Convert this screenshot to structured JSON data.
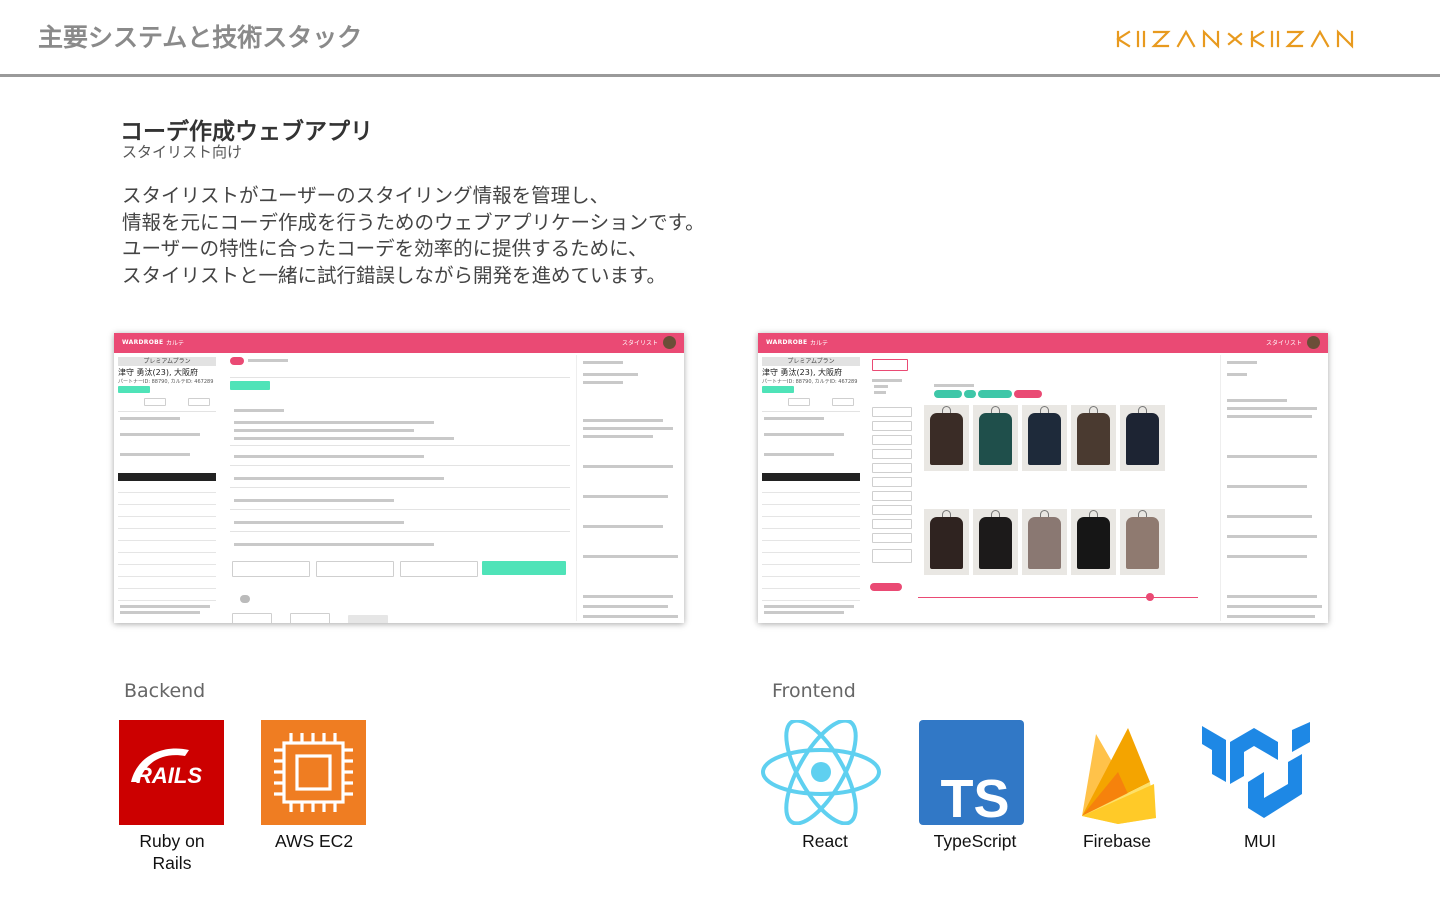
{
  "header": {
    "title": "主要システムと技術スタック",
    "brand_logo_text": "KIIZAN × KIIZAN"
  },
  "section": {
    "title": "コーデ作成ウェブアプリ",
    "subtitle": "スタイリスト向け",
    "description_lines": [
      "スタイリストがユーザーのスタイリング情報を管理し、",
      "情報を元にコーデ作成を行うためのウェブアプリケーションです。",
      "ユーザーの特性に合ったコーデを効率的に提供するために、",
      "スタイリストと一緒に試行錯誤しながら開発を進めています。"
    ]
  },
  "screenshots": {
    "app_brand": "WARDROBE",
    "calendar_label": "カルテ",
    "user_label": "スタイリスト",
    "plan_label": "プレミアムプラン",
    "customer_name": "津守 勇汰(23), 大阪府",
    "customer_id": "パートナーID: 88790, カルテID: 467289",
    "left_add_coord_label": "コーデ作成",
    "right_items_label": "アイテム一覧",
    "garment_colors": [
      "#3a2c26",
      "#1f4f4b",
      "#1e2a3a",
      "#4a3a30",
      "#1d2433",
      "#2f2320",
      "#1c1a1a",
      "#8a7872",
      "#161616",
      "#8f7a70"
    ],
    "accent_color": "#ea4a74",
    "cta_color": "#4fe3b8"
  },
  "backend": {
    "heading": "Backend",
    "items": [
      {
        "label": "Ruby on\nRails",
        "icon": "rails-logo"
      },
      {
        "label": "AWS EC2",
        "icon": "aws-ec2-logo"
      }
    ]
  },
  "frontend": {
    "heading": "Frontend",
    "items": [
      {
        "label": "React",
        "icon": "react-logo"
      },
      {
        "label": "TypeScript",
        "icon": "typescript-logo"
      },
      {
        "label": "Firebase",
        "icon": "firebase-logo"
      },
      {
        "label": "MUI",
        "icon": "mui-logo"
      }
    ]
  },
  "logo_text": {
    "rails": "RAILS",
    "ts": "TS"
  }
}
